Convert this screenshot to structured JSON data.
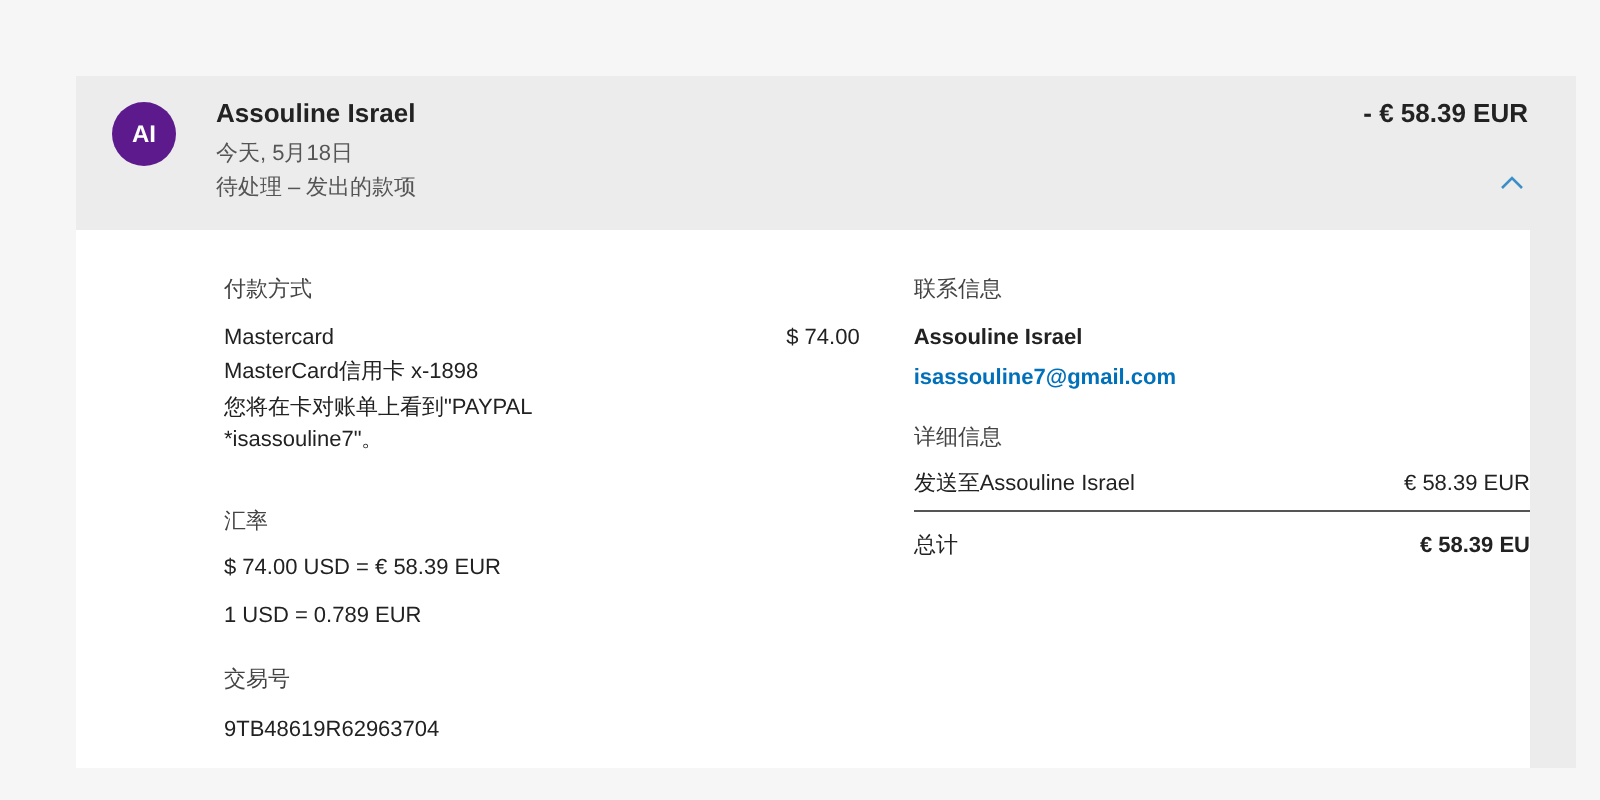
{
  "transaction": {
    "avatar": "AI",
    "name": "Assouline Israel",
    "date": "今天, 5月18日",
    "status": "待处理 – 发出的款项",
    "amount": "- € 58.39 EUR",
    "expanded": true
  },
  "payment": {
    "heading": "付款方式",
    "method": "Mastercard",
    "method_amount": "$ 74.00",
    "card": "MasterCard信用卡 x-1898",
    "note": "您将在卡对账单上看到\"PAYPAL *isassouline7\"。"
  },
  "exchange": {
    "heading": "汇率",
    "lines": [
      "$ 74.00 USD = € 58.39 EUR",
      "1 USD = 0.789 EUR"
    ]
  },
  "transaction_id": {
    "heading": "交易号",
    "value": "9TB48619R62963704"
  },
  "contact": {
    "heading": "联系信息",
    "name": "Assouline Israel",
    "email": "isassouline7@gmail.com"
  },
  "details": {
    "heading": "详细信息",
    "rows": [
      {
        "label": "发送至Assouline Israel",
        "value": "€ 58.39 EUR"
      }
    ],
    "total_label": "总计",
    "total_value": "€ 58.39 EU"
  }
}
